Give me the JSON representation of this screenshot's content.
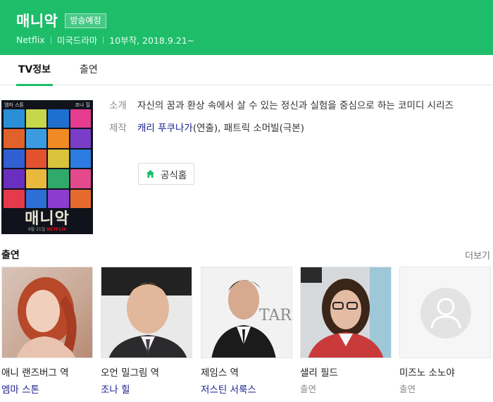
{
  "header": {
    "title": "매니악",
    "badge": "방송예정",
    "network": "Netflix",
    "genre": "미국드라마",
    "episodes_date": "10부작, 2018.9.21~"
  },
  "tabs": [
    {
      "label": "TV정보",
      "active": true
    },
    {
      "label": "출연",
      "active": false
    }
  ],
  "poster": {
    "top_left": "엠마 스톤",
    "top_right": "조나 힐",
    "logo": "매니악",
    "footer_date": "9월 21일",
    "footer_brand": "NETFLIX"
  },
  "info": {
    "intro_label": "소개",
    "intro_text": "자신의 꿈과 환상 속에서 살 수 있는 정신과 실험을 중심으로 하는 코미디 시리즈",
    "production_label": "제작",
    "director_name": "캐리 푸쿠나가",
    "director_role": "(연출), ",
    "writer_name": "패트릭 소머빌",
    "writer_role": "(극본)",
    "homepage_label": "공식홈"
  },
  "cast": {
    "title": "출연",
    "more_label": "더보기",
    "items": [
      {
        "role": "애니 랜즈버그 역",
        "actor": "엠마 스톤"
      },
      {
        "role": "오언 밀그림 역",
        "actor": "조나 힐"
      },
      {
        "role": "제임스 역",
        "actor": "저스틴 서룩스"
      },
      {
        "role": "샐리 필드",
        "actor": "출연"
      },
      {
        "role": "미즈노 소노야",
        "actor": "출연"
      }
    ]
  },
  "colors": {
    "brand_green": "#1ebd6a",
    "link_blue": "#1a1f8c"
  }
}
